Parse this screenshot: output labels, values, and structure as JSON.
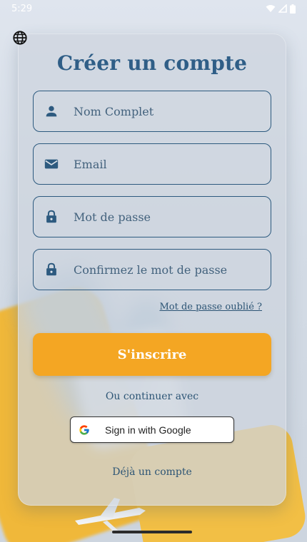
{
  "status_bar": {
    "time": "5:29"
  },
  "screen": {
    "title": "Créer un compte",
    "fields": [
      {
        "placeholder": "Nom Complet",
        "icon": "person-icon"
      },
      {
        "placeholder": "Email",
        "icon": "mail-icon"
      },
      {
        "placeholder": "Mot de passe",
        "icon": "lock-icon"
      },
      {
        "placeholder": "Confirmez le mot de passe",
        "icon": "lock-icon"
      }
    ],
    "forgot_password": "Mot de passe oublié ?",
    "signup_label": "S'inscrire",
    "or_continue": "Ou continuer avec",
    "google_label": "Sign in with Google",
    "login_link": "Déjà un compte"
  },
  "colors": {
    "accent": "#f4a623",
    "primary": "#2f5e87"
  }
}
